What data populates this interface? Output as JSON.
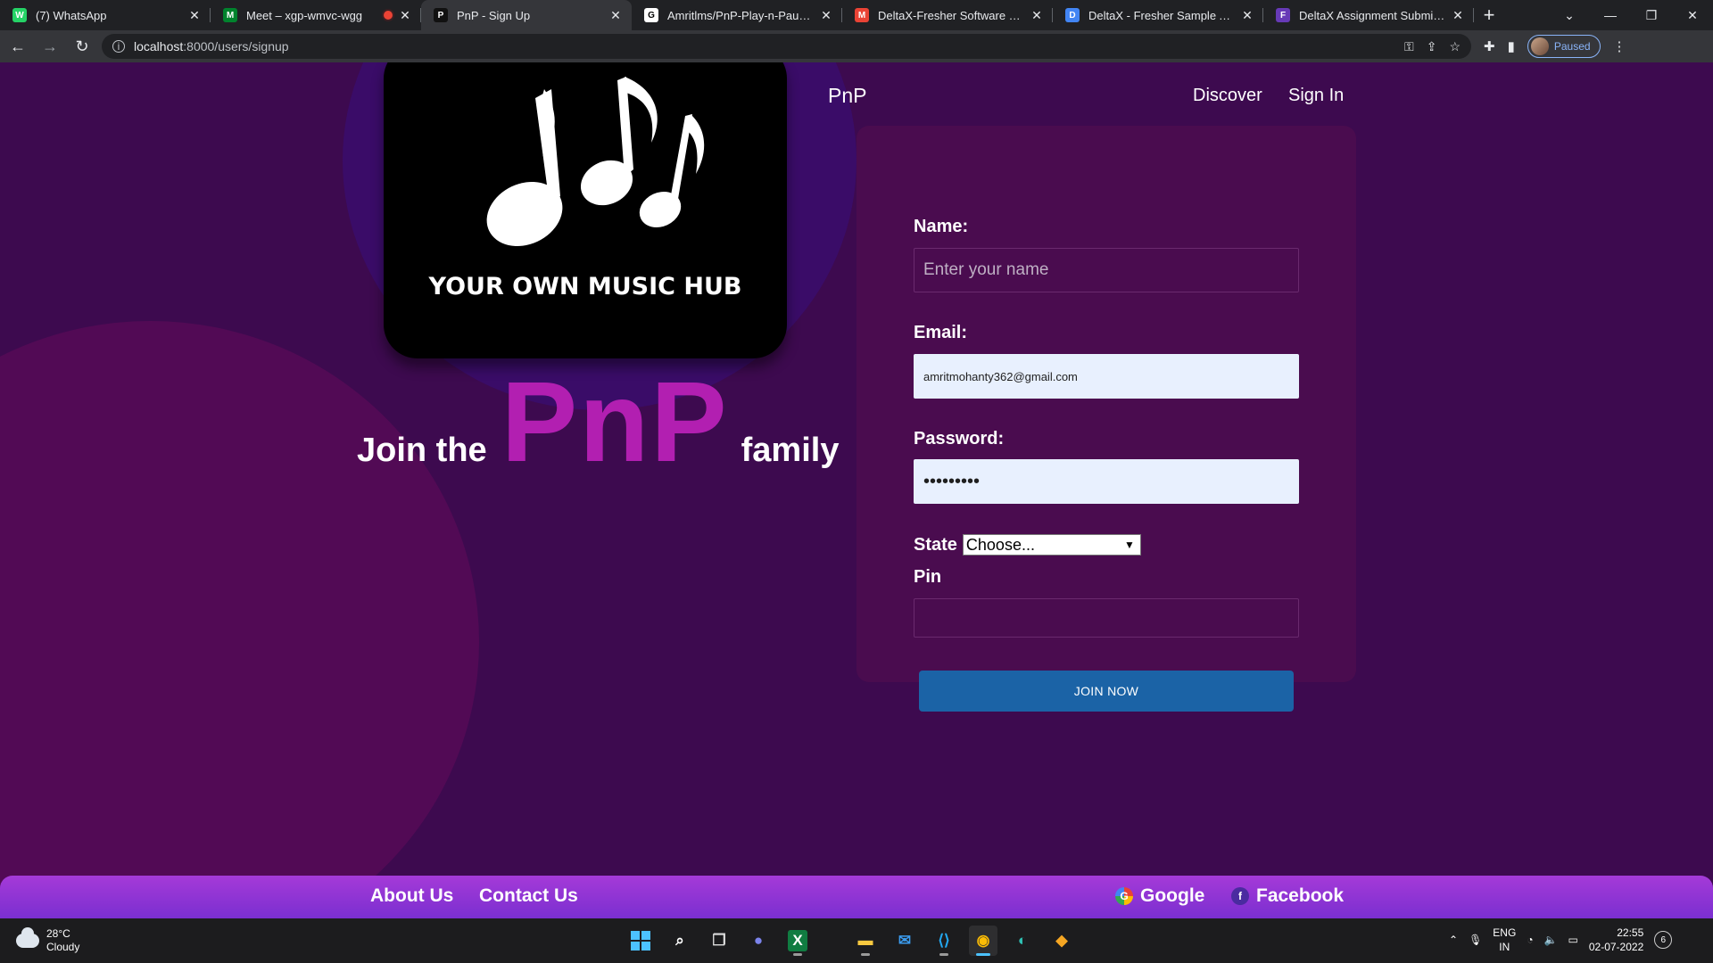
{
  "browser": {
    "tabs": [
      {
        "title": "(7) WhatsApp",
        "favicon_color": "#25d366",
        "favicon_glyph": "W"
      },
      {
        "title": "Meet – xgp-wmvc-wgg",
        "favicon_color": "#00832d",
        "favicon_glyph": "M",
        "recording": true
      },
      {
        "title": "PnP - Sign Up",
        "favicon_color": "#111111",
        "favicon_glyph": "P",
        "active": true
      },
      {
        "title": "Amritlms/PnP-Play-n-Pause-: It...",
        "favicon_color": "#ffffff",
        "favicon_glyph": "G"
      },
      {
        "title": "DeltaX-Fresher Software Engine...",
        "favicon_color": "#ea4335",
        "favicon_glyph": "M"
      },
      {
        "title": "DeltaX - Fresher Sample App - S...",
        "favicon_color": "#4285f4",
        "favicon_glyph": "D"
      },
      {
        "title": "DeltaX Assignment Submission",
        "favicon_color": "#673ab7",
        "favicon_glyph": "F"
      }
    ],
    "address": {
      "host": "localhost",
      "path": ":8000/users/signup"
    },
    "profile_status": "Paused"
  },
  "site": {
    "brand": "PnP",
    "nav": {
      "discover": "Discover",
      "sign_in": "Sign In"
    },
    "logo_tagline": "YOUR OWN MUSIC HUB",
    "headline": {
      "prefix": "Join the",
      "brand": "PnP",
      "suffix": "family"
    },
    "accent_color": "#b21fb1"
  },
  "form": {
    "name_label": "Name:",
    "name_placeholder": "Enter your name",
    "email_label": "Email:",
    "email_value": "amritmohanty362@gmail.com",
    "password_label": "Password:",
    "password_mask": "•••••••••",
    "state_label": "State",
    "state_selected": "Choose...",
    "pin_label": "Pin",
    "pin_value": "",
    "submit_label": "JOIN NOW",
    "submit_color": "#1b63a6"
  },
  "footer": {
    "about": "About Us",
    "contact": "Contact Us",
    "google": "Google",
    "facebook": "Facebook"
  },
  "taskbar": {
    "weather_temp": "28°C",
    "weather_desc": "Cloudy",
    "lang_top": "ENG",
    "lang_bottom": "IN",
    "time": "22:55",
    "date": "02-07-2022",
    "notification_count": "6"
  }
}
